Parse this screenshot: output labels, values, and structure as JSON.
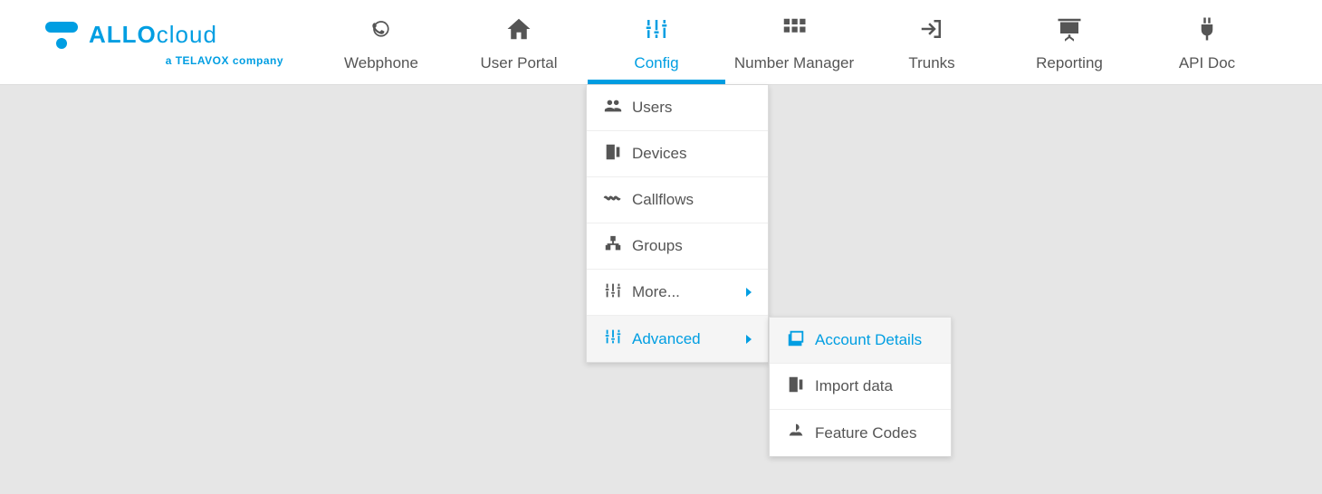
{
  "logo": {
    "text_bold": "ALLO",
    "text_light": "cloud",
    "subtitle_prefix": "a ",
    "subtitle_bold": "TELAVOX",
    "subtitle_suffix": " company"
  },
  "nav": {
    "webphone": "Webphone",
    "user_portal": "User Portal",
    "config": "Config",
    "number_manager": "Number Manager",
    "trunks": "Trunks",
    "reporting": "Reporting",
    "api_doc": "API Doc"
  },
  "config_menu": {
    "users": "Users",
    "devices": "Devices",
    "callflows": "Callflows",
    "groups": "Groups",
    "more": "More...",
    "advanced": "Advanced"
  },
  "advanced_submenu": {
    "account_details": "Account Details",
    "import_data": "Import data",
    "feature_codes": "Feature Codes"
  }
}
